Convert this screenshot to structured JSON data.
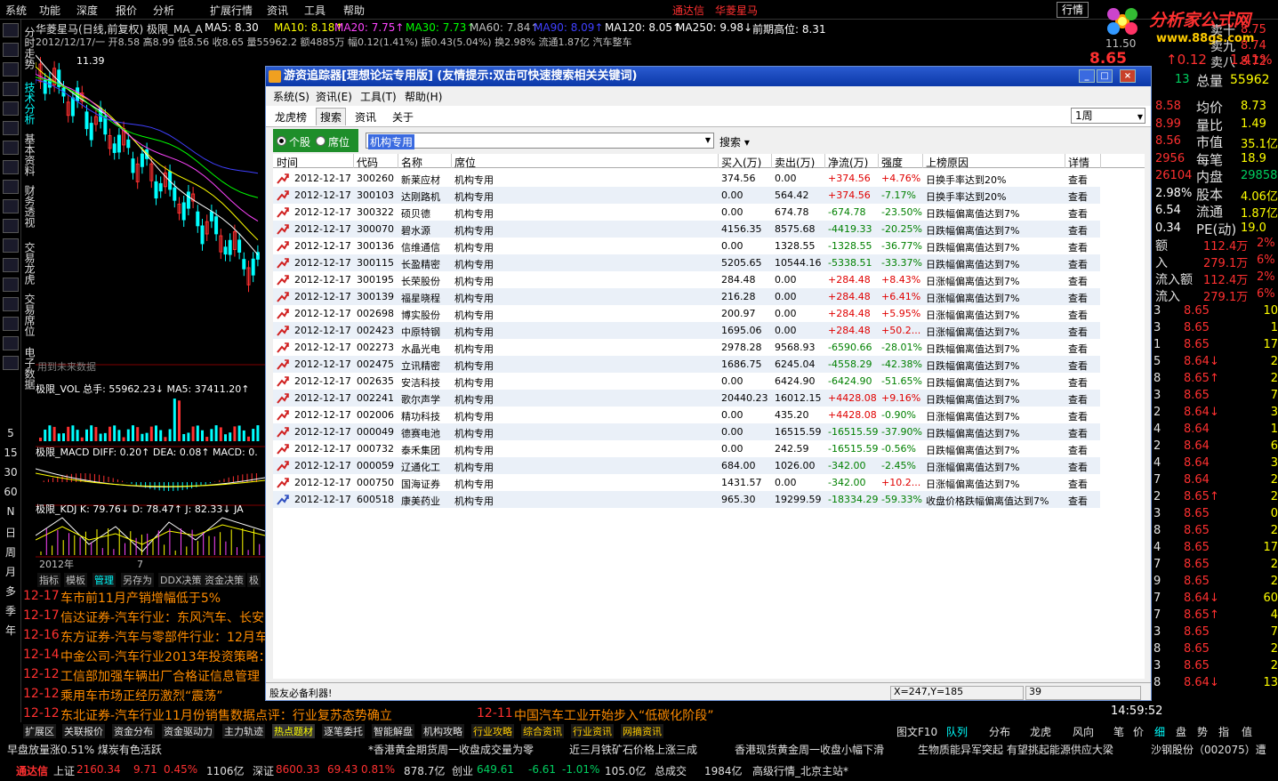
{
  "menubar": {
    "items": [
      "系统",
      "功能",
      "深度",
      "报价",
      "分析",
      "扩展行情",
      "资讯",
      "工具",
      "帮助"
    ],
    "brand1": "通达信",
    "brand2": "华菱星马",
    "hq": "行情",
    "winctl": "_ □ ×"
  },
  "logo": {
    "text": "分析家公式网",
    "url": "www.88gs.com"
  },
  "info": {
    "line1": "华菱星马(日线,前复权) 极限_MA_A",
    "ma5": "MA5: 8.30",
    "ma10": "MA10: 8.18↑",
    "ma20": "MA20: 7.75↑",
    "ma30": "MA30: 7.73↑",
    "ma60": "MA60: 7.84↑",
    "ma90": "MA90: 8.09↑",
    "ma120": "MA120: 8.05↑",
    "ma250": "MA250: 9.98↓",
    "high": "前期高位: 8.31",
    "line2": "2012/12/17/一 开8.58 高8.99 低8.56 收8.65 量55962.2 额4885万 幅0.12(1.41%) 振0.43(5.04%) 换2.98% 流通1.87亿 汽车整车"
  },
  "left_toolbar": {
    "nums": [
      "5",
      "15",
      "30",
      "60",
      "N",
      "日",
      "周",
      "月",
      "多",
      "季",
      "年"
    ]
  },
  "vtabs": [
    "分时走势",
    "技术分析",
    "基本资料",
    "财务透视",
    "交易龙虎",
    "交易席位",
    "电子数据"
  ],
  "chart": {
    "vol_label": "极限_VOL 总手: 55962.23↓ MA5: 37411.20↑",
    "macd_label": "极限_MACD DIFF: 0.20↑ DEA: 0.08↑ MACD: 0.",
    "kdj_label": "极限_KDJ K: 79.76↓ D: 78.47↑ J: 82.33↓ JA",
    "ref": "用到未来数据",
    "year": "2012年",
    "month": "7",
    "price_tag": "11.39",
    "level": "11.50",
    "tabs": [
      "指标",
      "模板",
      "管理",
      "另存为",
      "DDX决策",
      "资金决策",
      "极"
    ]
  },
  "orderbook": [
    {
      "label": "卖十",
      "price": "8.75",
      "vol": "15"
    },
    {
      "label": "卖九",
      "price": "8.74",
      "vol": "16"
    },
    {
      "label": "卖八",
      "price": "8.72",
      "vol": "30"
    }
  ],
  "right_panel": {
    "price": "8.65",
    "change": "↑0.12",
    "pct": "1.41%",
    "total_label": "总量",
    "total": "55962",
    "vol13": "13",
    "stats": [
      {
        "v": "8.58",
        "l": "均价",
        "r": "8.73"
      },
      {
        "v": "8.99",
        "l": "量比",
        "r": "1.49"
      },
      {
        "v": "8.56",
        "l": "市值",
        "r": "35.1亿"
      },
      {
        "v": "2956",
        "l": "每笔",
        "r": "18.9"
      },
      {
        "v": "26104",
        "l": "内盘",
        "r": "29858"
      },
      {
        "v": "2.98%",
        "l": "股本",
        "r": "4.06亿"
      },
      {
        "v": "6.54",
        "l": "流通",
        "r": "1.87亿"
      },
      {
        "v": "0.34",
        "l": "PE(动)",
        "r": "19.0"
      }
    ],
    "flows": [
      {
        "l": "额",
        "v": "112.4万",
        "p": "2%"
      },
      {
        "l": "入",
        "v": "279.1万",
        "p": "6%"
      },
      {
        "l": "流入额",
        "v": "112.4万",
        "p": "2%"
      },
      {
        "l": "流入",
        "v": "279.1万",
        "p": "6%"
      }
    ],
    "ticks": [
      [
        "3",
        "8.65",
        "10"
      ],
      [
        "3",
        "8.65",
        "1"
      ],
      [
        "1",
        "8.65",
        "17"
      ],
      [
        "5",
        "8.64↓",
        "2"
      ],
      [
        "8",
        "8.65↑",
        "2"
      ],
      [
        "3",
        "8.65",
        "7"
      ],
      [
        "2",
        "8.64↓",
        "3"
      ],
      [
        "4",
        "8.64",
        "1"
      ],
      [
        "2",
        "8.64",
        "6"
      ],
      [
        "4",
        "8.64",
        "3"
      ],
      [
        "7",
        "8.64",
        "2"
      ],
      [
        "2",
        "8.65↑",
        "2"
      ],
      [
        "3",
        "8.65",
        "0"
      ],
      [
        "8",
        "8.65",
        "2"
      ],
      [
        "4",
        "8.65",
        "17"
      ],
      [
        "7",
        "8.65",
        "2"
      ],
      [
        "9",
        "8.65",
        "2"
      ],
      [
        "7",
        "8.64↓",
        "60"
      ],
      [
        "7",
        "8.65↑",
        "4"
      ],
      [
        "3",
        "8.65",
        "7"
      ],
      [
        "8",
        "8.65",
        "2"
      ],
      [
        "3",
        "8.65",
        "2"
      ],
      [
        "8",
        "8.64↓",
        "13"
      ]
    ],
    "time": "14:59:52",
    "tabs": [
      "笔",
      "价",
      "细",
      "盘",
      "势",
      "指",
      "值"
    ]
  },
  "news": [
    {
      "d": "12-17",
      "t": "车市前11月产销增幅低于5%"
    },
    {
      "d": "12-17",
      "t": "信达证券-汽车行业：东风汽车、长安"
    },
    {
      "d": "12-16",
      "t": "东方证券-汽车与零部件行业：12月车"
    },
    {
      "d": "12-14",
      "t": "中金公司-汽车行业2013年投资策略："
    },
    {
      "d": "12-12",
      "t": "工信部加强车辆出厂合格证信息管理"
    },
    {
      "d": "12-12",
      "t": "乘用车市场正经历激烈“震荡”"
    },
    {
      "d": "12-12",
      "t": "东北证券-汽车行业11月份销售数据点评：行业复苏态势确立"
    }
  ],
  "news_extra": {
    "d": "12-11",
    "t": "中国汽车工业开始步入“低碳化阶段”"
  },
  "bottom_tabs": [
    "扩展区",
    "关联报价",
    "资金分布",
    "资金驱动力",
    "主力轨迹",
    "热点题材",
    "逐笔委托",
    "智能解盘",
    "机构攻略",
    "行业攻略",
    "综合资讯",
    "行业资讯",
    "网摘资讯"
  ],
  "bottom_tabs2": [
    "图文F10",
    "队列",
    "分布",
    "龙虎",
    "风向"
  ],
  "ticker": [
    "早盘放量涨0.51% 煤炭有色活跃",
    "*香港黄金期货周一收盘成交量为零",
    "近三月铁矿石价格上涨三成",
    "香港现货黄金周一收盘小幅下滑",
    "生物质能异军突起 有望挑起能源供应大梁",
    "沙钢股份（002075）遭"
  ],
  "index": {
    "app": "通达信",
    "sh_label": "上证",
    "sh": "2160.34",
    "sh_chg": "9.71",
    "sh_pct": "0.45%",
    "sh_amt": "1106亿",
    "sz_label": "深证",
    "sz": "8600.33",
    "sz_chg": "69.43",
    "sz_pct": "0.81%",
    "sz_amt": "878.7亿",
    "cy_label": "创业",
    "cy": "649.61",
    "cy_chg": "-6.61",
    "cy_pct": "-1.01%",
    "cy_amt": "105.0亿",
    "total_label": "总成交",
    "total": "1984亿",
    "site": "高级行情_北京主站*"
  },
  "dialog": {
    "title": "游资追踪器[理想论坛专用版] (友情提示:双击可快速搜索相关关键词)",
    "menu": [
      "系统(S)",
      "资讯(E)",
      "工具(T)",
      "帮助(H)"
    ],
    "tabs": [
      "龙虎榜",
      "搜索",
      "资讯",
      "关于"
    ],
    "active_tab": "搜索",
    "period": "1周",
    "radio1": "个股",
    "radio2": "席位",
    "query": "机构专用",
    "search_btn": "搜索",
    "columns": [
      "时间",
      "代码",
      "名称",
      "席位",
      "买入(万)",
      "卖出(万)",
      "净流(万)",
      "强度",
      "上榜原因",
      "详情"
    ],
    "rows": [
      [
        "2012-12-17",
        "300260",
        "新莱应材",
        "机构专用",
        "374.56",
        "0.00",
        "+374.56",
        "+4.76%",
        "日换手率达到20%",
        "查看"
      ],
      [
        "2012-12-17",
        "300103",
        "达刚路机",
        "机构专用",
        "0.00",
        "564.42",
        "+374.56",
        "-7.17%",
        "日换手率达到20%",
        "查看"
      ],
      [
        "2012-12-17",
        "300322",
        "硕贝德",
        "机构专用",
        "0.00",
        "674.78",
        "-674.78",
        "-23.50%",
        "日跌幅偏离值达到7%",
        "查看"
      ],
      [
        "2012-12-17",
        "300070",
        "碧水源",
        "机构专用",
        "4156.35",
        "8575.68",
        "-4419.33",
        "-20.25%",
        "日跌幅偏离值达到7%",
        "查看"
      ],
      [
        "2012-12-17",
        "300136",
        "信维通信",
        "机构专用",
        "0.00",
        "1328.55",
        "-1328.55",
        "-36.77%",
        "日跌幅偏离值达到7%",
        "查看"
      ],
      [
        "2012-12-17",
        "300115",
        "长盈精密",
        "机构专用",
        "5205.65",
        "10544.16",
        "-5338.51",
        "-33.37%",
        "日跌幅偏离值达到7%",
        "查看"
      ],
      [
        "2012-12-17",
        "300195",
        "长荣股份",
        "机构专用",
        "284.48",
        "0.00",
        "+284.48",
        "+8.43%",
        "日涨幅偏离值达到7%",
        "查看"
      ],
      [
        "2012-12-17",
        "300139",
        "福星晓程",
        "机构专用",
        "216.28",
        "0.00",
        "+284.48",
        "+6.41%",
        "日涨幅偏离值达到7%",
        "查看"
      ],
      [
        "2012-12-17",
        "002698",
        "博实股份",
        "机构专用",
        "200.97",
        "0.00",
        "+284.48",
        "+5.95%",
        "日涨幅偏离值达到7%",
        "查看"
      ],
      [
        "2012-12-17",
        "002423",
        "中原特钢",
        "机构专用",
        "1695.06",
        "0.00",
        "+284.48",
        "+50.2...",
        "日涨幅偏离值达到7%",
        "查看"
      ],
      [
        "2012-12-17",
        "002273",
        "水晶光电",
        "机构专用",
        "2978.28",
        "9568.93",
        "-6590.66",
        "-28.01%",
        "日跌幅偏离值达到7%",
        "查看"
      ],
      [
        "2012-12-17",
        "002475",
        "立讯精密",
        "机构专用",
        "1686.75",
        "6245.04",
        "-4558.29",
        "-42.38%",
        "日跌幅偏离值达到7%",
        "查看"
      ],
      [
        "2012-12-17",
        "002635",
        "安洁科技",
        "机构专用",
        "0.00",
        "6424.90",
        "-6424.90",
        "-51.65%",
        "日跌幅偏离值达到7%",
        "查看"
      ],
      [
        "2012-12-17",
        "002241",
        "歌尔声学",
        "机构专用",
        "20440.23",
        "16012.15",
        "+4428.08",
        "+9.16%",
        "日跌幅偏离值达到7%",
        "查看"
      ],
      [
        "2012-12-17",
        "002006",
        "精功科技",
        "机构专用",
        "0.00",
        "435.20",
        "+4428.08",
        "-0.90%",
        "日涨幅偏离值达到7%",
        "查看"
      ],
      [
        "2012-12-17",
        "000049",
        "德赛电池",
        "机构专用",
        "0.00",
        "16515.59",
        "-16515.59",
        "-37.90%",
        "日跌幅偏离值达到7%",
        "查看"
      ],
      [
        "2012-12-17",
        "000732",
        "泰禾集团",
        "机构专用",
        "0.00",
        "242.59",
        "-16515.59",
        "-0.56%",
        "日跌幅偏离值达到7%",
        "查看"
      ],
      [
        "2012-12-17",
        "000059",
        "辽通化工",
        "机构专用",
        "684.00",
        "1026.00",
        "-342.00",
        "-2.45%",
        "日涨幅偏离值达到7%",
        "查看"
      ],
      [
        "2012-12-17",
        "000750",
        "国海证券",
        "机构专用",
        "1431.57",
        "0.00",
        "-342.00",
        "+10.2...",
        "日涨幅偏离值达到7%",
        "查看"
      ],
      [
        "2012-12-17",
        "600518",
        "康美药业",
        "机构专用",
        "965.30",
        "19299.59",
        "-18334.29",
        "-59.33%",
        "收盘价格跌幅偏离值达到7%",
        "查看"
      ]
    ],
    "status_left": "股友必备利器!",
    "status_xy": "X=247,Y=185",
    "status_num": "39"
  },
  "colors": {
    "up": "#ff3030",
    "down": "#00d060",
    "yellow": "#ffff00",
    "cyan": "#00ffff",
    "dialog_blue": "#0b38a8",
    "radio_green": "#1e8e2a"
  }
}
